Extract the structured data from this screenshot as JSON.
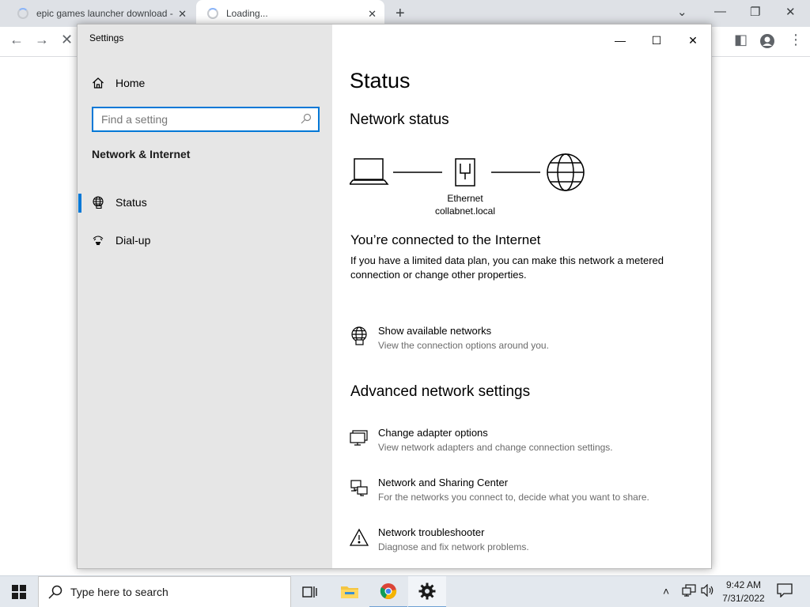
{
  "browser": {
    "tabs": [
      {
        "label": "epic games launcher download -"
      },
      {
        "label": "Loading..."
      }
    ]
  },
  "settings": {
    "window_title": "Settings",
    "sidebar": {
      "home_label": "Home",
      "search_placeholder": "Find a setting",
      "section_label": "Network & Internet",
      "items": [
        {
          "label": "Status",
          "icon": "globe-icon",
          "active": true
        },
        {
          "label": "Dial-up",
          "icon": "dialup-icon",
          "active": false
        }
      ]
    },
    "main": {
      "title": "Status",
      "network_status_heading": "Network status",
      "diagram": {
        "adapter_name": "Ethernet",
        "domain": "collabnet.local"
      },
      "connected_heading": "You’re connected to the Internet",
      "connected_desc": "If you have a limited data plan, you can make this network a metered connection or change other properties.",
      "show_networks": {
        "title": "Show available networks",
        "subtitle": "View the connection options around you."
      },
      "advanced_heading": "Advanced network settings",
      "advanced_items": [
        {
          "title": "Change adapter options",
          "subtitle": "View network adapters and change connection settings.",
          "icon": "adapter-icon"
        },
        {
          "title": "Network and Sharing Center",
          "subtitle": "For the networks you connect to, decide what you want to share.",
          "icon": "sharing-center-icon"
        },
        {
          "title": "Network troubleshooter",
          "subtitle": "Diagnose and fix network problems.",
          "icon": "warning-icon"
        }
      ]
    }
  },
  "taskbar": {
    "search_placeholder": "Type here to search",
    "time": "9:42 AM",
    "date": "7/31/2022",
    "apps": [
      "task-view-icon",
      "file-explorer-icon",
      "chrome-icon",
      "settings-gear-icon"
    ]
  }
}
